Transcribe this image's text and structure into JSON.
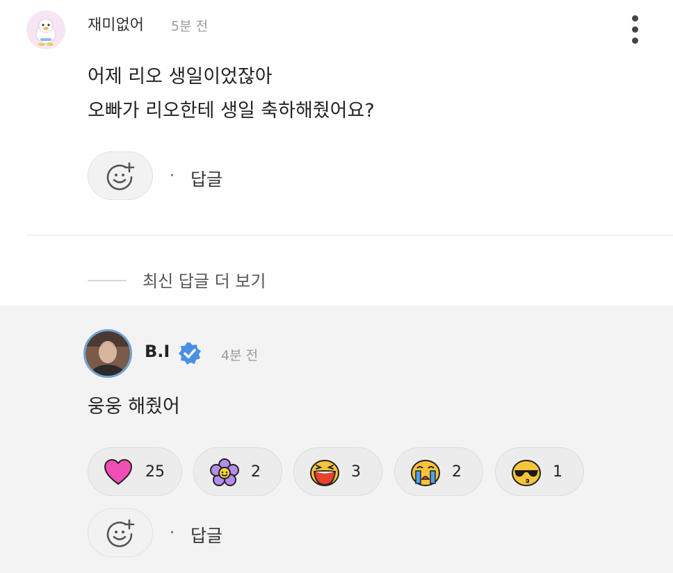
{
  "comment": {
    "author": "재미없어",
    "time": "5분 전",
    "lines": [
      "어제 리오 생일이었잖아",
      "오빠가 리오한테 생일 축하해줬어요?"
    ],
    "reply_label": "답글",
    "separator": "·"
  },
  "more_replies_label": "최신 답글 더 보기",
  "reply": {
    "author": "B.I",
    "time": "4분 전",
    "text": "웅웅 해줬어",
    "reply_label": "답글",
    "separator": "·",
    "reactions": [
      {
        "icon": "heart-icon",
        "count": "25"
      },
      {
        "icon": "flower-icon",
        "count": "2"
      },
      {
        "icon": "laughing-face-icon",
        "count": "3"
      },
      {
        "icon": "crying-face-icon",
        "count": "2"
      },
      {
        "icon": "sunglasses-face-icon",
        "count": "1"
      }
    ]
  },
  "colors": {
    "verified": "#4a90e2",
    "heart": "#f04fb5",
    "flower": "#b58cf0",
    "face": "#f7c33a",
    "reply_background": "#f3f3f3"
  }
}
